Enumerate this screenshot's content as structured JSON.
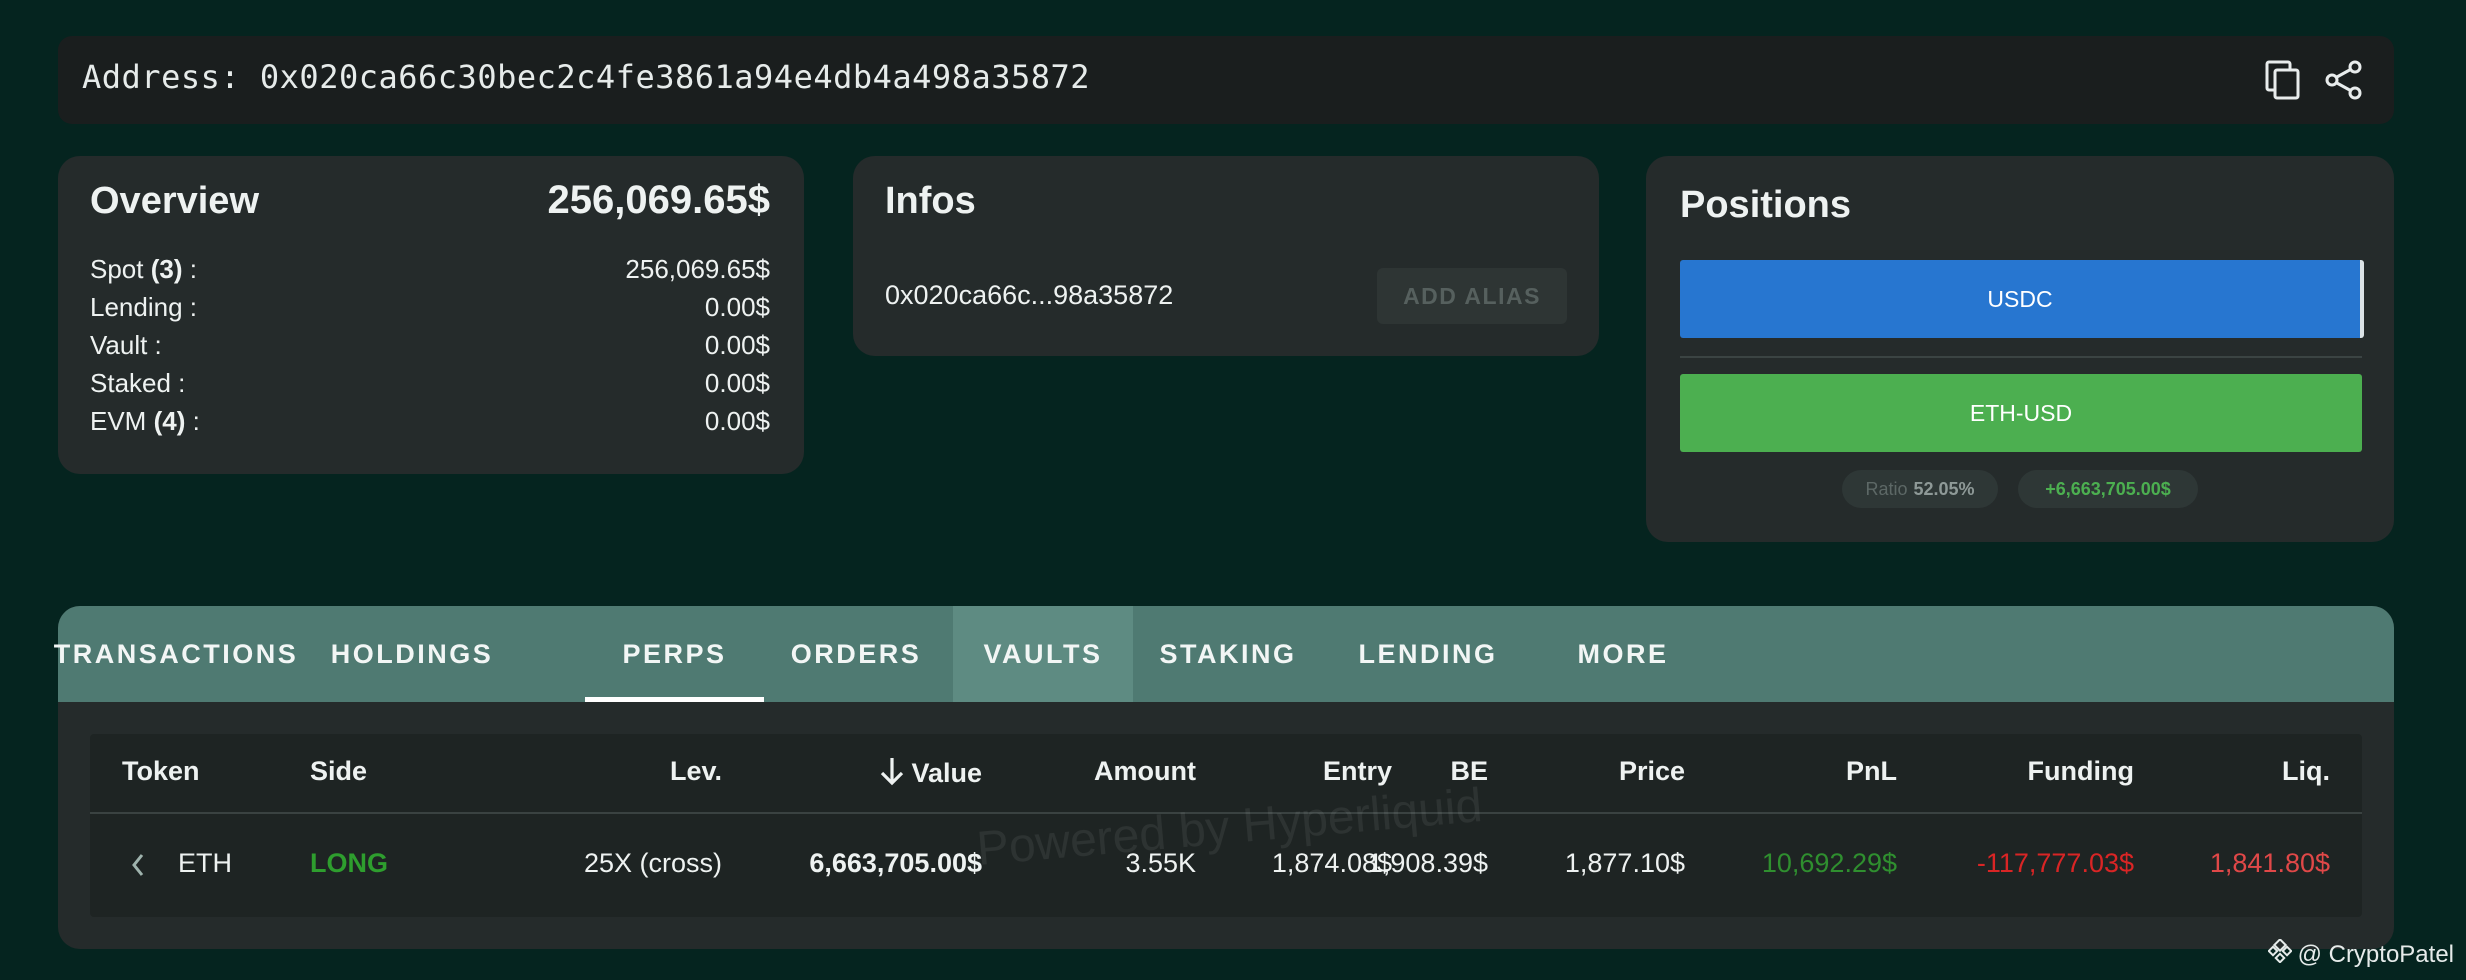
{
  "address_bar": {
    "label": "Address: 0x020ca66c30bec2c4fe3861a94e4db4a498a35872"
  },
  "overview": {
    "title": "Overview",
    "total": "256,069.65$",
    "rows": [
      {
        "label": "Spot ",
        "count": "(3)",
        "suffix": " :",
        "value": "256,069.65$"
      },
      {
        "label": "Lending :",
        "count": "",
        "suffix": "",
        "value": "0.00$"
      },
      {
        "label": "Vault :",
        "count": "",
        "suffix": "",
        "value": "0.00$"
      },
      {
        "label": "Staked :",
        "count": "",
        "suffix": "",
        "value": "0.00$"
      },
      {
        "label": "EVM ",
        "count": "(4)",
        "suffix": " :",
        "value": "0.00$"
      }
    ]
  },
  "infos": {
    "title": "Infos",
    "short_address": "0x020ca66c...98a35872",
    "add_alias_label": "ADD ALIAS"
  },
  "positions": {
    "title": "Positions",
    "bars": [
      {
        "label": "USDC",
        "color": "#2776d0"
      },
      {
        "label": "ETH-USD",
        "color": "#4caf50"
      }
    ],
    "ratio_label": "Ratio",
    "ratio_value": "52.05%",
    "pnl_chip": "+6,663,705.00$"
  },
  "tabs": [
    {
      "label": "TRANSACTIONS"
    },
    {
      "label": "HOLDINGS"
    },
    {
      "label": "PERPS",
      "active": true
    },
    {
      "label": "ORDERS"
    },
    {
      "label": "VAULTS",
      "hovered": true
    },
    {
      "label": "STAKING"
    },
    {
      "label": "LENDING"
    },
    {
      "label": "MORE"
    }
  ],
  "table": {
    "headers": {
      "token": "Token",
      "side": "Side",
      "lev": "Lev.",
      "value": "Value",
      "amount": "Amount",
      "entry": "Entry",
      "be": "BE",
      "price": "Price",
      "pnl": "PnL",
      "funding": "Funding",
      "liq": "Liq."
    },
    "sort_icon": "arrow-down-icon",
    "rows": [
      {
        "token": "ETH",
        "side": "LONG",
        "lev": "25X (cross)",
        "value": "6,663,705.00$",
        "amount": "3.55K",
        "entry": "1,874.08$",
        "be": "1,908.39$",
        "price": "1,877.10$",
        "pnl": "10,692.29$",
        "funding": "-117,777.03$",
        "liq": "1,841.80$"
      }
    ]
  },
  "watermark": "Powered by Hyperliquid",
  "credit": "@ CryptoPatel",
  "colors": {
    "background": "#05241f",
    "card": "#252b2b",
    "tabbar": "#4f7a72",
    "long": "#2e9e2e",
    "pnl_positive": "#2f8f2f",
    "negative": "#d92525",
    "liq": "#e04848"
  }
}
